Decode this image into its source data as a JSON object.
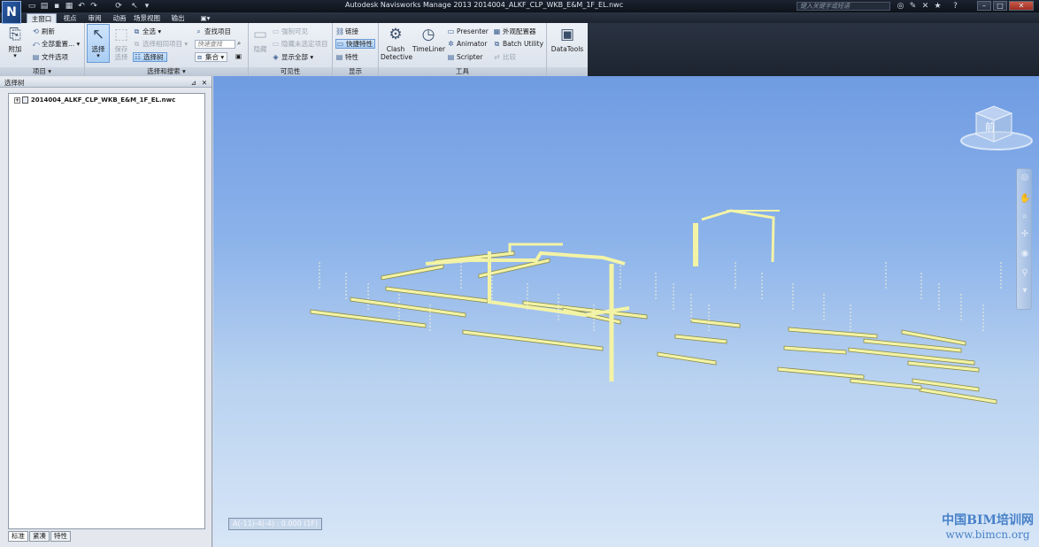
{
  "titlebar": {
    "app_logo": "N",
    "title": "Autodesk Navisworks Manage 2013    2014004_ALKF_CLP_WKB_E&M_1F_EL.nwc",
    "help_search_placeholder": "键入关键字或短语"
  },
  "tabs": [
    {
      "label": "主窗口",
      "active": true
    },
    {
      "label": "视点"
    },
    {
      "label": "审阅"
    },
    {
      "label": "动画"
    },
    {
      "label": "场景视图"
    },
    {
      "label": "输出"
    }
  ],
  "ribbon": {
    "project": {
      "label": "项目 ▾",
      "append": "附加",
      "refresh": "刷新",
      "reset_all": "全部重置...",
      "file_options": "文件选项"
    },
    "select_search": {
      "label": "选择和搜索 ▾",
      "select": "选择",
      "save_selection": "保存",
      "save_selection_2": "选择",
      "select_all": "全选",
      "select_same": "选择相同项目",
      "selection_tree": "选择树",
      "find_items": "查找项目",
      "quick_find_placeholder": "快速查找",
      "sets": "集合"
    },
    "visibility": {
      "label": "可见性",
      "hide": "隐藏",
      "require": "强制可见",
      "hide_unselected": "隐藏未选定项目",
      "unhide_all": "显示全部"
    },
    "display": {
      "label": "显示",
      "links": "链接",
      "quick_props": "快捷特性",
      "properties": "特性"
    },
    "tools": {
      "label": "工具",
      "clash_1": "Clash",
      "clash_2": "Detective",
      "timeliner": "TimeLiner",
      "presenter": "Presenter",
      "animator": "Animator",
      "scripter": "Scripter",
      "appearance_profiler": "外观配置器",
      "batch_utility": "Batch Utility",
      "compare": "比较"
    },
    "datatools": {
      "label": "DataTools"
    }
  },
  "left_pane": {
    "title": "选择树",
    "tree_item": "2014004_ALKF_CLP_WKB_E&M_1F_EL.nwc",
    "tabs": [
      "标准",
      "紧凑",
      "特性"
    ]
  },
  "viewport": {
    "coord_readout": "A(-11)-4(-4) : 0.000 (1F)",
    "viewcube_face": "前",
    "watermark_line1": "中国BIM培训网",
    "watermark_line2": "www.bimcn.org"
  },
  "colors": {
    "model_fill": "#f3f3a6",
    "model_stroke": "#8c8c45",
    "sky_top": "#6f9be2",
    "sky_bottom": "#d7e6f7"
  }
}
